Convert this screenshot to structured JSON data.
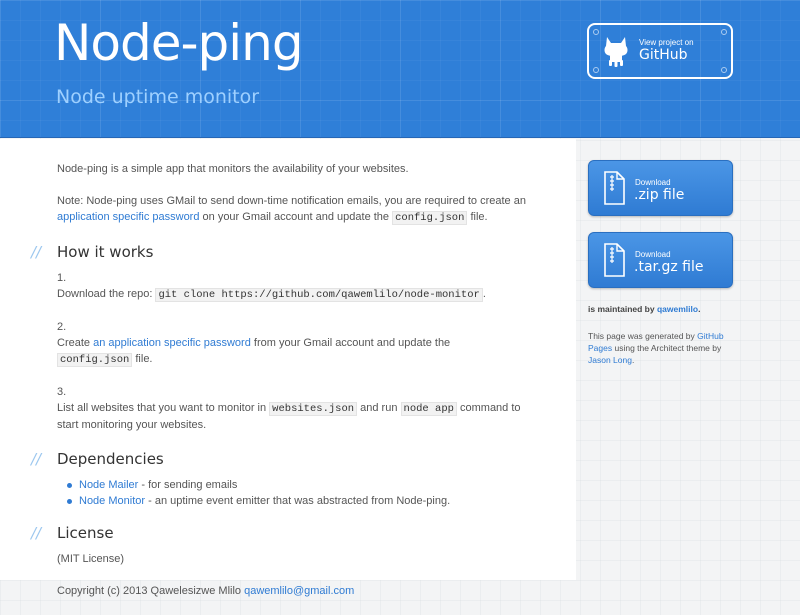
{
  "header": {
    "title": "Node-ping",
    "tagline": "Node uptime monitor",
    "github": {
      "small": "View project on",
      "big": "GitHub"
    }
  },
  "intro": "Node-ping is a simple app that monitors the availability of your websites.",
  "note": {
    "pre": "Note: Node-ping uses GMail to send down-time notification emails, you are required to create an ",
    "link": "application specific password",
    "mid": " on your Gmail account and update the ",
    "code": "config.json",
    "post": " file."
  },
  "how": {
    "title": "How it works",
    "step1": {
      "num": "1.",
      "pre": "Download the repo: ",
      "code": "git clone https://github.com/qawemlilo/node-monitor"
    },
    "step2": {
      "num": "2.",
      "pre": "Create ",
      "link": "an application specific password",
      "mid": " from your Gmail account and update the ",
      "code": "config.json",
      "post": " file."
    },
    "step3": {
      "num": "3.",
      "pre": "List all websites that you want to monitor in ",
      "code1": "websites.json",
      "mid": " and run ",
      "code2": "node app",
      "post": " command to start monitoring your websites."
    }
  },
  "deps": {
    "title": "Dependencies",
    "items": [
      {
        "link": "Node Mailer",
        "text": " - for sending emails"
      },
      {
        "link": "Node Monitor",
        "text": " - an uptime event emitter that was abstracted from Node-ping."
      }
    ]
  },
  "license": {
    "title": "License",
    "text": "(MIT License)",
    "copyright": "Copyright (c) 2013 Qawelesizwe Mlilo ",
    "email": "qawemlilo@gmail.com"
  },
  "sidebar": {
    "zip": {
      "small": "Download",
      "big": ".zip file"
    },
    "tar": {
      "small": "Download",
      "big": ".tar.gz file"
    },
    "maint_pre": "is maintained by ",
    "maint_link": "qawemlilo",
    "maint_post": ".",
    "credits_pre": "This page was generated by ",
    "credits_link1": "GitHub Pages",
    "credits_mid": " using the Architect theme by ",
    "credits_link2": "Jason Long",
    "credits_post": "."
  },
  "slashes": "//",
  "colors": {
    "header": "#2f7fd8",
    "link": "#2f7bd3",
    "tagline": "#9ed0ff"
  }
}
